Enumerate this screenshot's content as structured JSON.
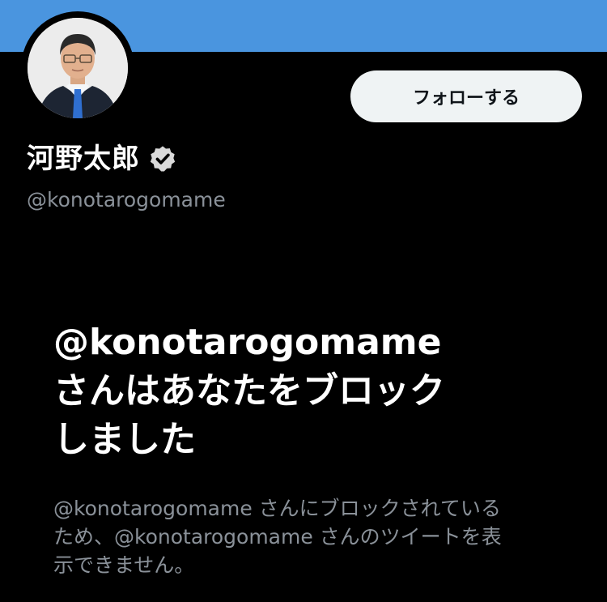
{
  "profile": {
    "display_name": "河野太郎",
    "handle": "@konotarogomame",
    "verified_icon": "verified-badge-icon",
    "avatar": "avatar-photo",
    "banner_color": "#4a95df"
  },
  "actions": {
    "follow_label": "フォローする"
  },
  "blocked_notice": {
    "title_line1": "@konotarogomame",
    "title_line2": "さんはあなたをブロック",
    "title_line3": "しました",
    "description_line1": "@konotarogomame さんにブロックされている",
    "description_line2": "ため、@konotarogomame さんのツイートを表",
    "description_line3": "示できません。"
  },
  "colors": {
    "background": "#000000",
    "primary_text": "#ffffff",
    "secondary_text": "#8a9199",
    "button_bg": "#eff3f4",
    "button_text": "#0f1419"
  }
}
